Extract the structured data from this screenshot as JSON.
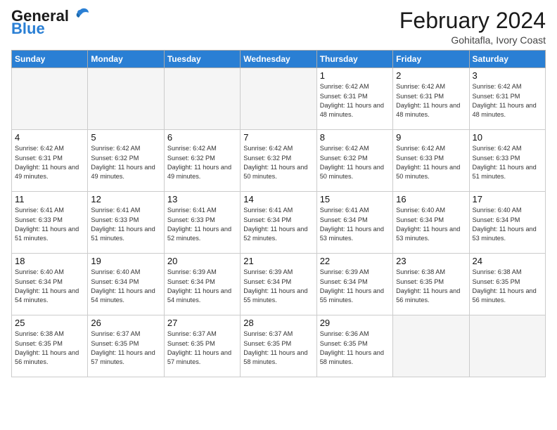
{
  "header": {
    "logo_general": "General",
    "logo_blue": "Blue",
    "month_title": "February 2024",
    "location": "Gohitafla, Ivory Coast"
  },
  "weekdays": [
    "Sunday",
    "Monday",
    "Tuesday",
    "Wednesday",
    "Thursday",
    "Friday",
    "Saturday"
  ],
  "weeks": [
    [
      {
        "day": "",
        "info": ""
      },
      {
        "day": "",
        "info": ""
      },
      {
        "day": "",
        "info": ""
      },
      {
        "day": "",
        "info": ""
      },
      {
        "day": "1",
        "info": "Sunrise: 6:42 AM\nSunset: 6:31 PM\nDaylight: 11 hours and 48 minutes."
      },
      {
        "day": "2",
        "info": "Sunrise: 6:42 AM\nSunset: 6:31 PM\nDaylight: 11 hours and 48 minutes."
      },
      {
        "day": "3",
        "info": "Sunrise: 6:42 AM\nSunset: 6:31 PM\nDaylight: 11 hours and 48 minutes."
      }
    ],
    [
      {
        "day": "4",
        "info": "Sunrise: 6:42 AM\nSunset: 6:31 PM\nDaylight: 11 hours and 49 minutes."
      },
      {
        "day": "5",
        "info": "Sunrise: 6:42 AM\nSunset: 6:32 PM\nDaylight: 11 hours and 49 minutes."
      },
      {
        "day": "6",
        "info": "Sunrise: 6:42 AM\nSunset: 6:32 PM\nDaylight: 11 hours and 49 minutes."
      },
      {
        "day": "7",
        "info": "Sunrise: 6:42 AM\nSunset: 6:32 PM\nDaylight: 11 hours and 50 minutes."
      },
      {
        "day": "8",
        "info": "Sunrise: 6:42 AM\nSunset: 6:32 PM\nDaylight: 11 hours and 50 minutes."
      },
      {
        "day": "9",
        "info": "Sunrise: 6:42 AM\nSunset: 6:33 PM\nDaylight: 11 hours and 50 minutes."
      },
      {
        "day": "10",
        "info": "Sunrise: 6:42 AM\nSunset: 6:33 PM\nDaylight: 11 hours and 51 minutes."
      }
    ],
    [
      {
        "day": "11",
        "info": "Sunrise: 6:41 AM\nSunset: 6:33 PM\nDaylight: 11 hours and 51 minutes."
      },
      {
        "day": "12",
        "info": "Sunrise: 6:41 AM\nSunset: 6:33 PM\nDaylight: 11 hours and 51 minutes."
      },
      {
        "day": "13",
        "info": "Sunrise: 6:41 AM\nSunset: 6:33 PM\nDaylight: 11 hours and 52 minutes."
      },
      {
        "day": "14",
        "info": "Sunrise: 6:41 AM\nSunset: 6:34 PM\nDaylight: 11 hours and 52 minutes."
      },
      {
        "day": "15",
        "info": "Sunrise: 6:41 AM\nSunset: 6:34 PM\nDaylight: 11 hours and 53 minutes."
      },
      {
        "day": "16",
        "info": "Sunrise: 6:40 AM\nSunset: 6:34 PM\nDaylight: 11 hours and 53 minutes."
      },
      {
        "day": "17",
        "info": "Sunrise: 6:40 AM\nSunset: 6:34 PM\nDaylight: 11 hours and 53 minutes."
      }
    ],
    [
      {
        "day": "18",
        "info": "Sunrise: 6:40 AM\nSunset: 6:34 PM\nDaylight: 11 hours and 54 minutes."
      },
      {
        "day": "19",
        "info": "Sunrise: 6:40 AM\nSunset: 6:34 PM\nDaylight: 11 hours and 54 minutes."
      },
      {
        "day": "20",
        "info": "Sunrise: 6:39 AM\nSunset: 6:34 PM\nDaylight: 11 hours and 54 minutes."
      },
      {
        "day": "21",
        "info": "Sunrise: 6:39 AM\nSunset: 6:34 PM\nDaylight: 11 hours and 55 minutes."
      },
      {
        "day": "22",
        "info": "Sunrise: 6:39 AM\nSunset: 6:34 PM\nDaylight: 11 hours and 55 minutes."
      },
      {
        "day": "23",
        "info": "Sunrise: 6:38 AM\nSunset: 6:35 PM\nDaylight: 11 hours and 56 minutes."
      },
      {
        "day": "24",
        "info": "Sunrise: 6:38 AM\nSunset: 6:35 PM\nDaylight: 11 hours and 56 minutes."
      }
    ],
    [
      {
        "day": "25",
        "info": "Sunrise: 6:38 AM\nSunset: 6:35 PM\nDaylight: 11 hours and 56 minutes."
      },
      {
        "day": "26",
        "info": "Sunrise: 6:37 AM\nSunset: 6:35 PM\nDaylight: 11 hours and 57 minutes."
      },
      {
        "day": "27",
        "info": "Sunrise: 6:37 AM\nSunset: 6:35 PM\nDaylight: 11 hours and 57 minutes."
      },
      {
        "day": "28",
        "info": "Sunrise: 6:37 AM\nSunset: 6:35 PM\nDaylight: 11 hours and 58 minutes."
      },
      {
        "day": "29",
        "info": "Sunrise: 6:36 AM\nSunset: 6:35 PM\nDaylight: 11 hours and 58 minutes."
      },
      {
        "day": "",
        "info": ""
      },
      {
        "day": "",
        "info": ""
      }
    ]
  ]
}
